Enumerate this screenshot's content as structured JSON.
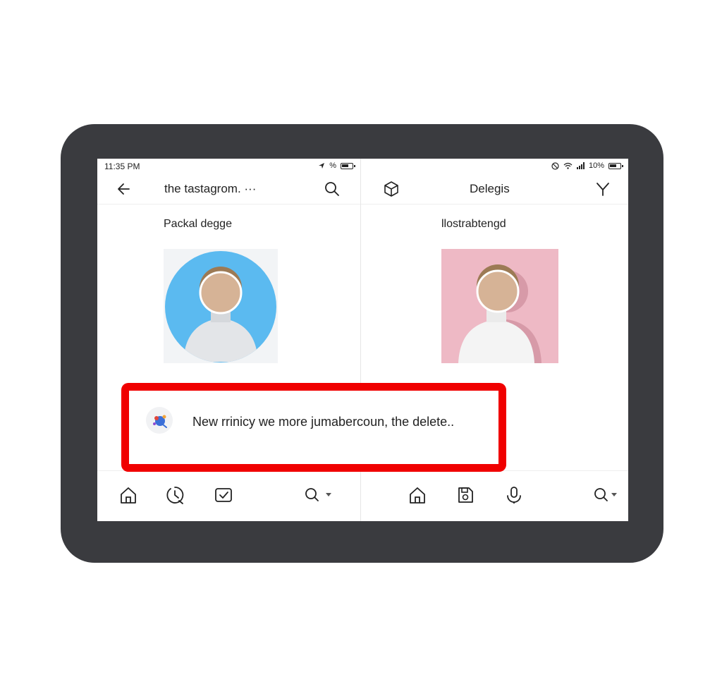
{
  "left_pane": {
    "status_time": "11:35 PM",
    "status_text": "%",
    "app_title": "the tastagrom. ···",
    "section_title": "Packal degge",
    "avatar_bg": "#5bbaf0"
  },
  "right_pane": {
    "status_text": "10%",
    "app_title": "Delegis",
    "section_title": "llostrabtengd",
    "avatar_bg": "#eeb9c5"
  },
  "toast": {
    "message": "New rrinicy we more jumabercoun, the delete..",
    "highlight_color": "#f00000"
  },
  "icons": {
    "left_appbar": [
      "back-arrow-icon",
      "search-icon"
    ],
    "right_appbar": [
      "cube-icon",
      "filter-icon"
    ],
    "left_bottom": [
      "home-icon",
      "history-icon",
      "check-box-icon",
      "search-dropdown-icon"
    ],
    "right_bottom": [
      "home-icon",
      "save-icon",
      "microphone-icon",
      "search-dropdown-icon"
    ]
  }
}
